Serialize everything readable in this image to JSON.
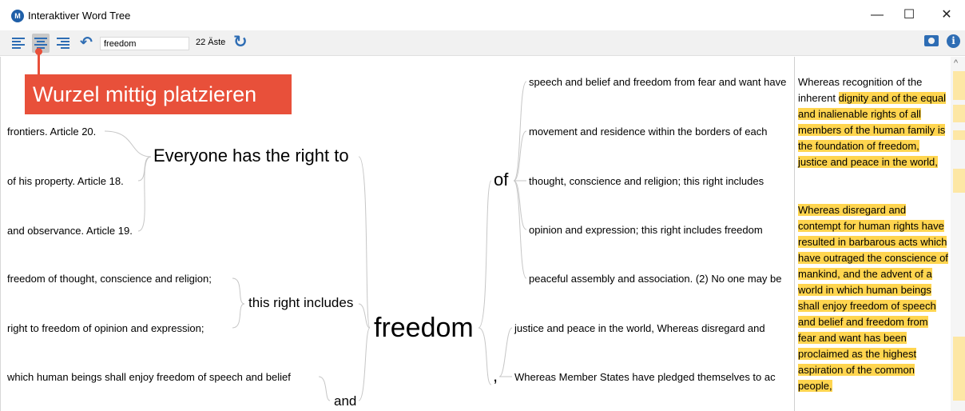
{
  "window": {
    "title": "Interaktiver Word Tree",
    "icon_letter": "M",
    "controls": {
      "minimize": "—",
      "maximize": "☐",
      "close": "✕"
    }
  },
  "toolbar": {
    "search_value": "freedom",
    "branch_count": "22 Äste",
    "undo_glyph": "↶",
    "refresh_glyph": "↻",
    "camera_glyph": "📷",
    "info_glyph": "i"
  },
  "tooltip": {
    "text": "Wurzel mittig platzieren"
  },
  "tree": {
    "root": "freedom",
    "left_branches": [
      {
        "phrase": "Everyone has the right to",
        "leaves": [
          "frontiers. Article 20.",
          "of his property. Article 18.",
          "and observance. Article 19."
        ]
      },
      {
        "phrase": "this right includes",
        "leaves": [
          "freedom of thought, conscience and religion;",
          "right to freedom of opinion and expression;"
        ]
      },
      {
        "phrase": "and",
        "leaves": [
          "which human beings shall enjoy freedom of speech and belief"
        ]
      }
    ],
    "right_branches": [
      {
        "phrase": "of",
        "leaves": [
          "speech and belief and freedom from fear and want have",
          "movement and residence within the borders of each",
          "thought, conscience and religion; this right includes",
          "opinion and expression; this right includes freedom",
          "peaceful assembly and association. (2) No one may be"
        ]
      },
      {
        "phrase": ",",
        "leaves": [
          "justice and peace in the world, Whereas disregard and",
          "Whereas Member States have pledged themselves to ac"
        ]
      }
    ]
  },
  "text_panel": {
    "para1_plain": "Whereas recognition of the inherent ",
    "para1_highlight": "dignity and of the equal and inalienable rights of all members of the human family is the foundation of freedom, justice and peace in the world,",
    "para2_highlight": "Whereas disregard and contempt for human rights have resulted in barbarous acts which have outraged the conscience of mankind, and the advent of a world in which human beings shall enjoy freedom of speech and belief and freedom from fear and want has been proclaimed as the highest aspiration of the common people,"
  },
  "colors": {
    "accent": "#2e6db4",
    "tooltip": "#e8503a",
    "highlight": "#ffd54f"
  }
}
